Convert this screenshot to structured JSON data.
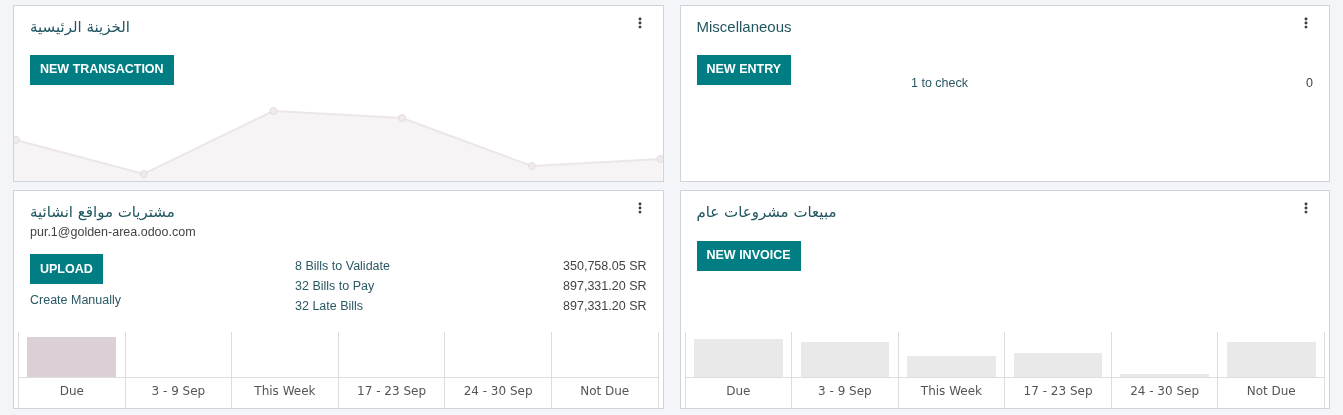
{
  "rows": [
    {
      "left": {
        "kind": "line",
        "title": "الخزينة الرئيسية",
        "button": "NEW TRANSACTION"
      },
      "right": {
        "kind": "misc",
        "title": "Miscellaneous",
        "button": "NEW ENTRY",
        "stats": [
          {
            "label": "1 to check",
            "value": "0"
          }
        ]
      }
    },
    {
      "left": {
        "kind": "purchase",
        "title": "مشتريات مواقع انشائية",
        "email": "pur.1@golden-area.odoo.com",
        "button": "UPLOAD",
        "link": "Create Manually",
        "stats": [
          {
            "label": "8 Bills to Validate",
            "value": "350,758.05 SR"
          },
          {
            "label": "32 Bills to Pay",
            "value": "897,331.20 SR"
          },
          {
            "label": "32 Late Bills",
            "value": "897,331.20 SR"
          }
        ],
        "chart_labels": [
          "Due",
          "3 - 9 Sep",
          "This Week",
          "17 - 23 Sep",
          "24 - 30 Sep",
          "Not Due"
        ]
      },
      "right": {
        "kind": "sale",
        "title": "مبيعات مشروعات عام",
        "button": "NEW INVOICE",
        "chart_labels": [
          "Due",
          "3 - 9 Sep",
          "This Week",
          "17 - 23 Sep",
          "24 - 30 Sep",
          "Not Due"
        ]
      }
    }
  ]
}
